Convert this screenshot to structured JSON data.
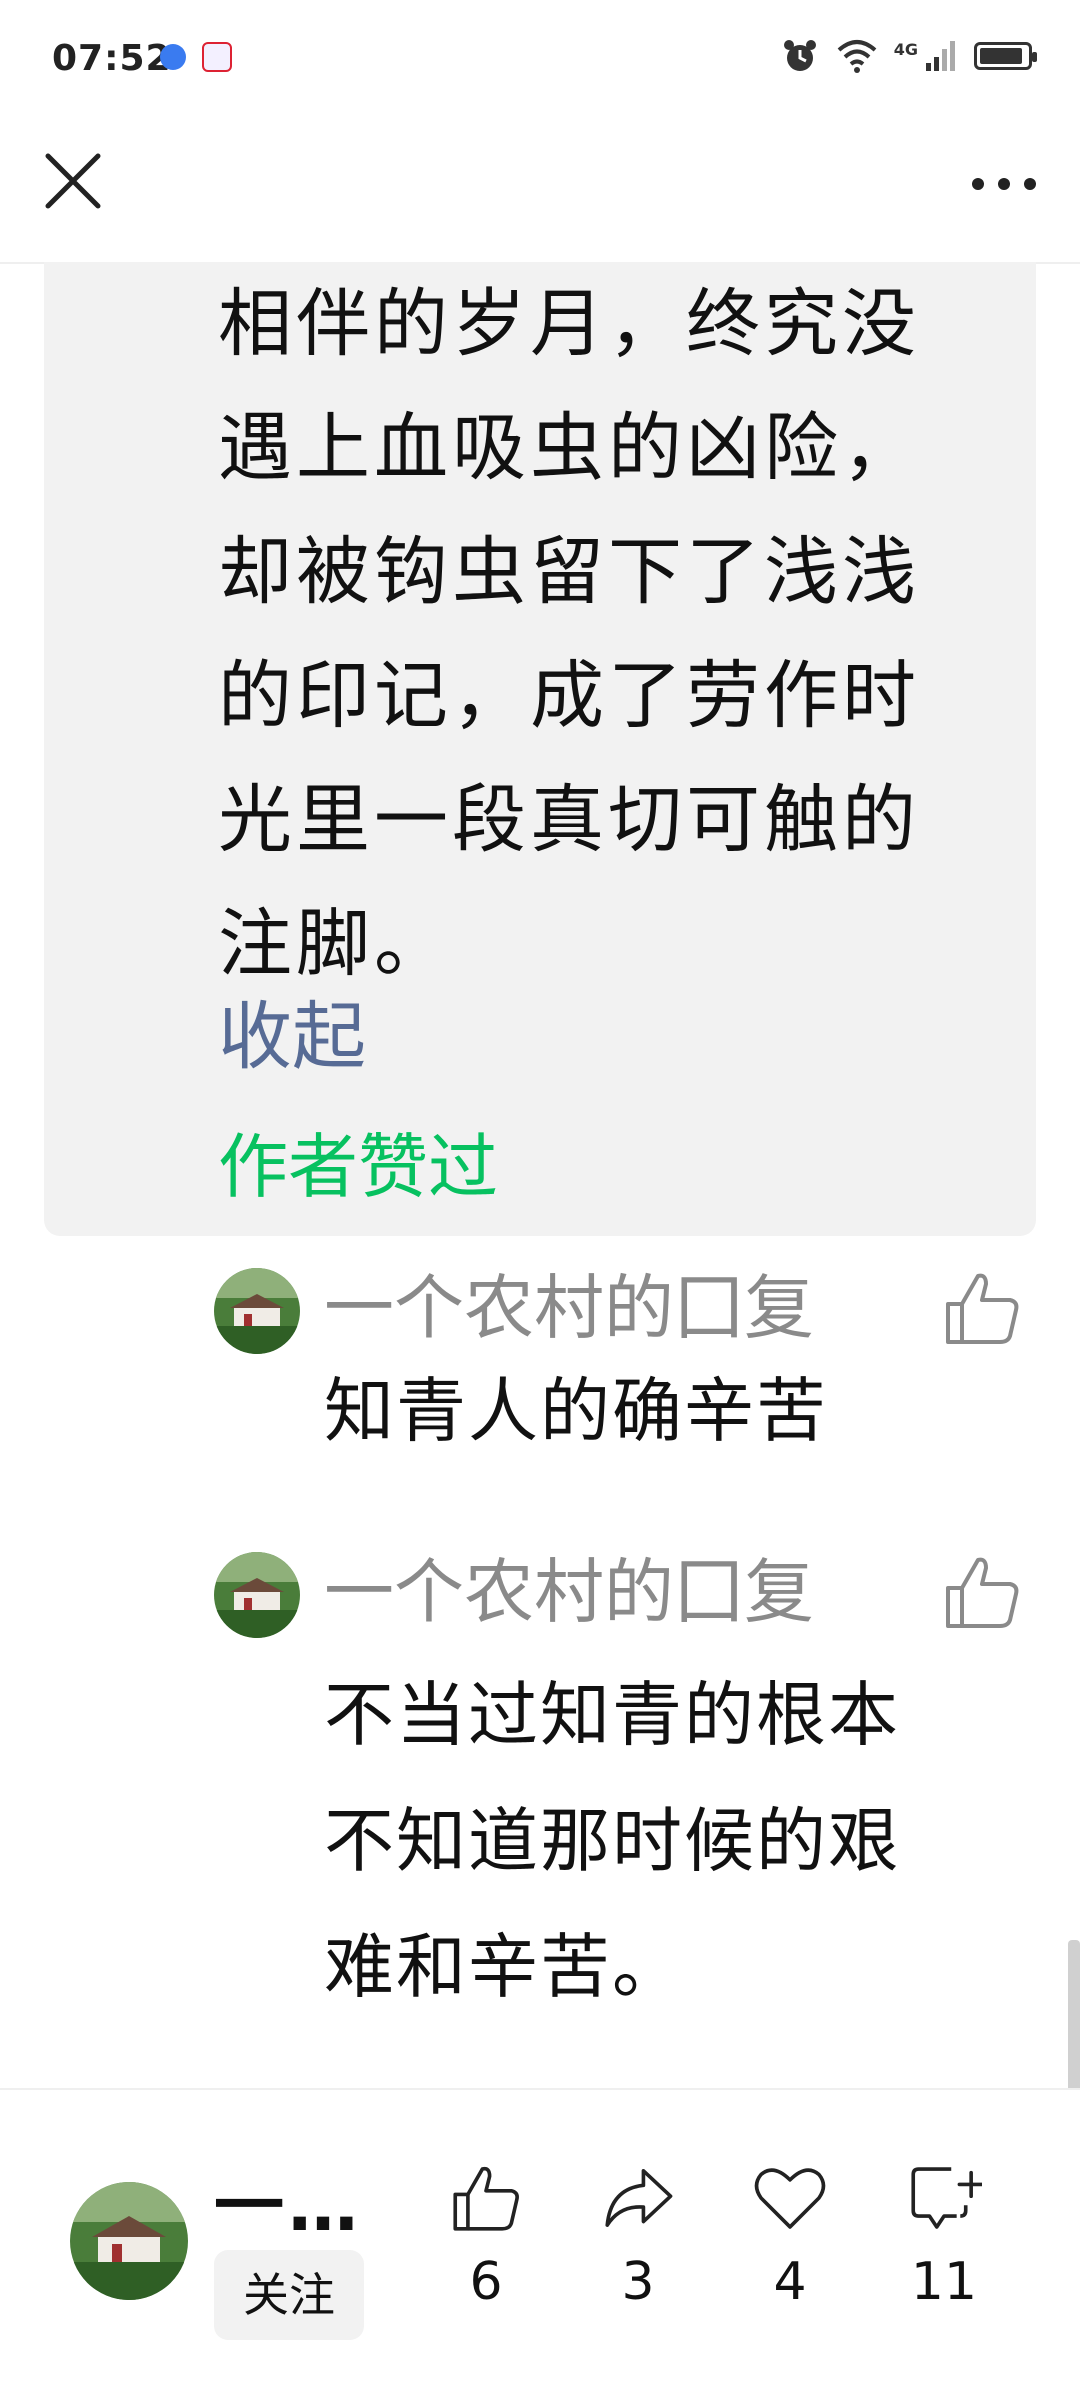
{
  "status_bar": {
    "time": "07:52",
    "network": "4G"
  },
  "article_comment": {
    "lines": [
      "相伴的岁月，终究没",
      "遇上血吸虫的凶险，",
      "却被钩虫留下了浅浅",
      "的印记，成了劳作时",
      "光里一段真切可触的",
      "注脚。"
    ],
    "collapse_label": "收起",
    "author_liked_label": "作者赞过"
  },
  "replies": [
    {
      "header": "一个农村的囗复",
      "body_lines": [
        "知青人的确辛苦"
      ]
    },
    {
      "header": "一个农村的囗复",
      "body_lines": [
        "不当过知青的根本",
        "不知道那时候的艰",
        "难和辛苦。"
      ]
    }
  ],
  "bottom_bar": {
    "author_name": "一…",
    "follow_label": "关注",
    "actions": [
      {
        "name": "like",
        "count": "6"
      },
      {
        "name": "share",
        "count": "3"
      },
      {
        "name": "favorite",
        "count": "4"
      },
      {
        "name": "comment",
        "count": "11"
      }
    ]
  },
  "icons": {
    "close": "close-icon",
    "more": "more-icon",
    "like": "thumbs-up-icon",
    "share": "share-icon",
    "favorite": "heart-icon",
    "comment": "comment-add-icon"
  },
  "colors": {
    "link": "#576b95",
    "author_liked": "#07c160",
    "card_bg": "#f2f2f2"
  }
}
